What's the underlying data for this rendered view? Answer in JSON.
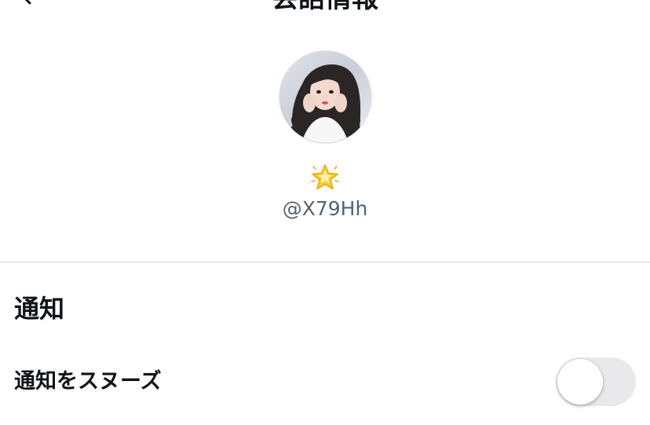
{
  "header": {
    "title": "会話情報",
    "back_icon": "chevron-left-icon"
  },
  "profile": {
    "emoji": "🌟",
    "handle": "@X79Hh"
  },
  "notifications": {
    "section_title": "通知",
    "snooze_label": "通知をスヌーズ",
    "snooze_enabled": false
  },
  "colors": {
    "handle": "#536471",
    "divider": "#cfd9de",
    "toggle_off": "#e9e9eb"
  }
}
